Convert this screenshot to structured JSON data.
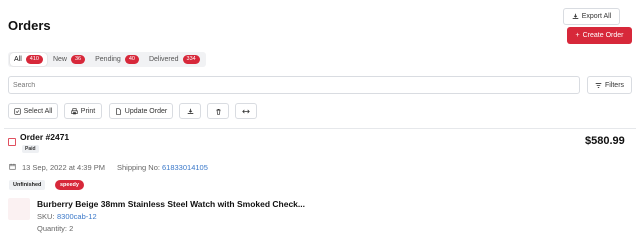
{
  "header": {
    "title": "Orders",
    "export_label": "Export All",
    "create_label": "Create Order"
  },
  "tabs": [
    {
      "label": "All",
      "count": "410"
    },
    {
      "label": "New",
      "count": "36"
    },
    {
      "label": "Pending",
      "count": "40"
    },
    {
      "label": "Delivered",
      "count": "334"
    }
  ],
  "search": {
    "placeholder": "Search",
    "value": ""
  },
  "filters_label": "Filters",
  "toolbar": {
    "select_all": "Select All",
    "print": "Print",
    "update_order": "Update Order"
  },
  "order": {
    "id": "Order #2471",
    "payment_status": "Paid",
    "total": "$580.99",
    "date": "13 Sep, 2022 at 4:39 PM",
    "shipping_label": "Shipping No:",
    "shipping_no": "61833014105",
    "fulfillment": "Unfinished",
    "delivery_type": "speedy",
    "product": {
      "name": "Burberry Beige 38mm Stainless Steel Watch with Smoked Check...",
      "sku_label": "SKU:",
      "sku": "8300cab-12",
      "quantity": "Quantity: 2"
    }
  },
  "colors": {
    "accent": "#d7283a",
    "link": "#3a78c9"
  }
}
